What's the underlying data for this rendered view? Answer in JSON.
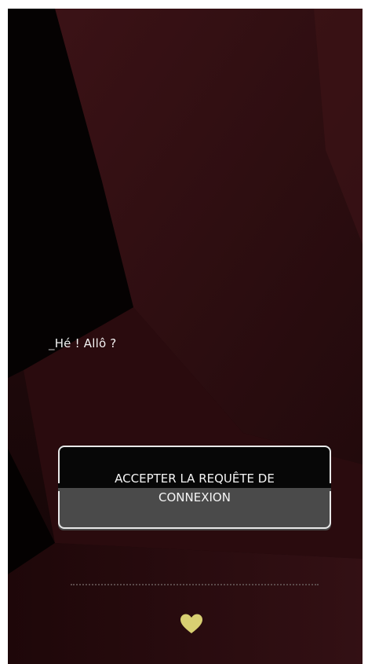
{
  "dialog": {
    "greeting": "Hé ! Allô ?",
    "cursor": "_",
    "accept_label_line1": "ACCEPTER LA REQUÊTE DE",
    "accept_label_line2": "CONNEXION"
  },
  "icons": {
    "heart": "heart-icon"
  },
  "colors": {
    "background": "#160607",
    "panel_red": "#3a1014",
    "button_dark": "#070707",
    "button_grey": "#4a4a4a",
    "button_border": "#e8e8e8",
    "heart": "#d8cf72"
  }
}
